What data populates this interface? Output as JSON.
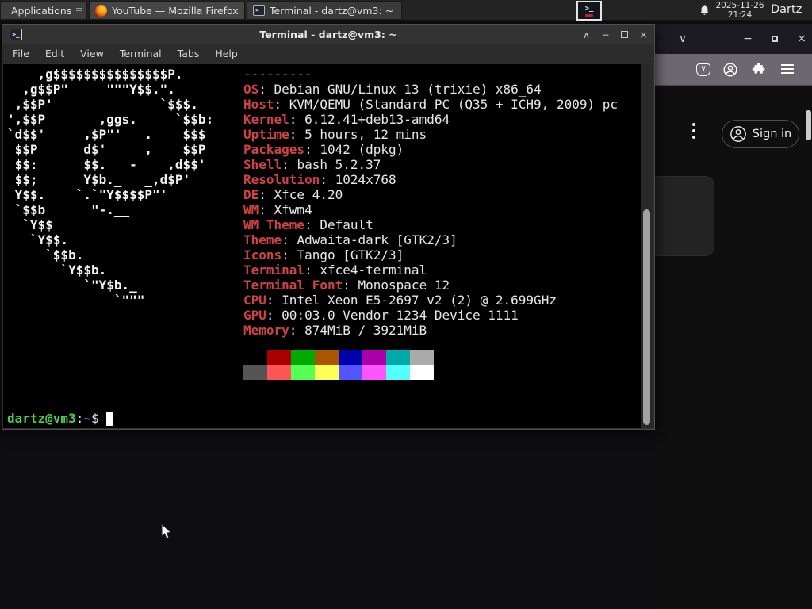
{
  "taskbar": {
    "applications": {
      "label": "Applications"
    },
    "tasks": [
      {
        "label": "YouTube — Mozilla Firefox"
      },
      {
        "label": "Terminal - dartz@vm3: ~"
      }
    ],
    "clock": {
      "date": "2025-11-26",
      "time": "21:24"
    },
    "user": "Dartz"
  },
  "terminal": {
    "title": "Terminal - dartz@vm3: ~",
    "menu": [
      "File",
      "Edit",
      "View",
      "Terminal",
      "Tabs",
      "Help"
    ],
    "neofetch": {
      "underline": "---------",
      "ascii_art_lines": [
        "    ,g$$$$$$$$$$$$$$$P.",
        "  ,g$$P\"     \"\"\"Y$$.\".",
        " ,$$P'              `$$$.",
        "',$$P       ,ggs.     `$$b:",
        "`d$$'     ,$P\"'   .    $$$",
        " $$P      d$'     ,    $$P",
        " $$:      $$.   -    ,d$$'",
        " $$;      Y$b._   _,d$P'",
        " Y$$.    `.`\"Y$$$$P\"'",
        " `$$b      \"-.__",
        "  `Y$$",
        "   `Y$$.",
        "     `$$b.",
        "       `Y$$b.",
        "          `\"Y$b._",
        "              `\"\"\""
      ],
      "info": [
        {
          "label": "OS",
          "value": "Debian GNU/Linux 13 (trixie) x86_64"
        },
        {
          "label": "Host",
          "value": "KVM/QEMU (Standard PC (Q35 + ICH9, 2009) pc"
        },
        {
          "label": "Kernel",
          "value": "6.12.41+deb13-amd64"
        },
        {
          "label": "Uptime",
          "value": "5 hours, 12 mins"
        },
        {
          "label": "Packages",
          "value": "1042 (dpkg)"
        },
        {
          "label": "Shell",
          "value": "bash 5.2.37"
        },
        {
          "label": "Resolution",
          "value": "1024x768"
        },
        {
          "label": "DE",
          "value": "Xfce 4.20"
        },
        {
          "label": "WM",
          "value": "Xfwm4"
        },
        {
          "label": "WM Theme",
          "value": "Default"
        },
        {
          "label": "Theme",
          "value": "Adwaita-dark [GTK2/3]"
        },
        {
          "label": "Icons",
          "value": "Tango [GTK2/3]"
        },
        {
          "label": "Terminal",
          "value": "xfce4-terminal"
        },
        {
          "label": "Terminal Font",
          "value": "Monospace 12"
        },
        {
          "label": "CPU",
          "value": "Intel Xeon E5-2697 v2 (2) @ 2.699GHz"
        },
        {
          "label": "GPU",
          "value": "00:03.0 Vendor 1234 Device 1111"
        },
        {
          "label": "Memory",
          "value": "874MiB / 3921MiB"
        }
      ],
      "palette_normal": [
        "#000000",
        "#aa0000",
        "#00aa00",
        "#aa5500",
        "#0000aa",
        "#aa00aa",
        "#00aaaa",
        "#aaaaaa"
      ],
      "palette_bright": [
        "#555555",
        "#ff5555",
        "#55ff55",
        "#ffff55",
        "#5555ff",
        "#ff55ff",
        "#55ffff",
        "#ffffff"
      ]
    },
    "prompt": {
      "user_host": "dartz@vm3",
      "separator": ":",
      "path": "~",
      "symbol": "$"
    }
  },
  "firefox": {
    "signin_label": "Sign in"
  },
  "colors": {
    "neofetch_label": "#cc4444",
    "prompt_user": "#4ecc4e",
    "prompt_path": "#5566cc",
    "terminal_bg": "#000000",
    "panel_bg": "#232323"
  }
}
